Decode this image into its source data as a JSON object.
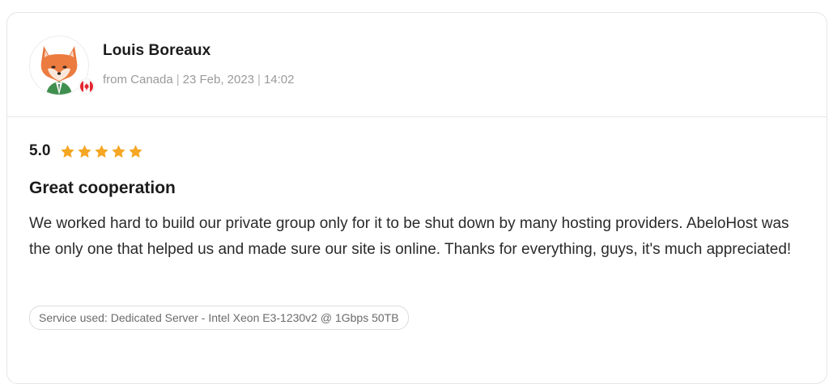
{
  "review": {
    "author": {
      "name": "Louis Boreaux",
      "avatar_icon": "fox-avatar-icon",
      "country_flag_icon": "canada-flag-icon",
      "location": "from Canada",
      "date": "23 Feb, 2023",
      "time": "14:02",
      "separator": "|"
    },
    "rating": {
      "value": "5.0",
      "stars": 5,
      "star_color": "#f5a623"
    },
    "title": "Great cooperation",
    "body": "We worked hard to build our private group only for it to be shut down by many hosting providers. AbeloHost was the only one that helped us and made sure our site is online. Thanks for everything, guys, it's much appreciated!",
    "service_tag": "Service used: Dedicated Server - Intel Xeon E3-1230v2 @ 1Gbps 50TB"
  },
  "colors": {
    "border": "#e6e6e6",
    "meta_text": "#9a9a9a",
    "star": "#f5a623",
    "flag_red": "#e3262e"
  }
}
